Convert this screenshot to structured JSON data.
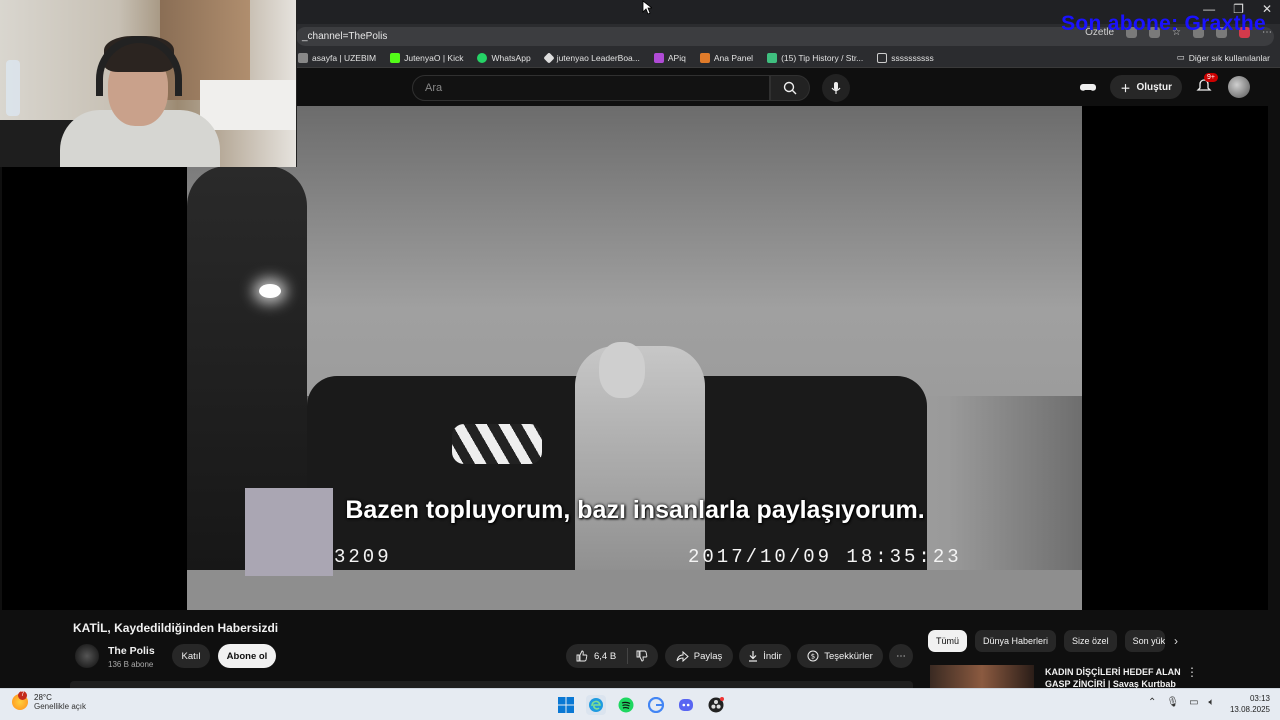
{
  "browser": {
    "url": "_channel=ThePolis",
    "url_right_label": "Özetle",
    "bookmarks": [
      {
        "label": "asayfa | UZEBIM",
        "color": "#888888"
      },
      {
        "label": "JutenyaO | Kick",
        "color": "#53fc18"
      },
      {
        "label": "WhatsApp",
        "color": "#25d366"
      },
      {
        "label": "jutenyao LeaderBoa...",
        "color": "#dddddd"
      },
      {
        "label": "APiq",
        "color": "#b04bd6"
      },
      {
        "label": "Ana Panel",
        "color": "#e07b2a"
      },
      {
        "label": "(15) Tip History / Str...",
        "color": "#3fbf7f"
      },
      {
        "label": "ssssssssss",
        "color": "#cccccc"
      }
    ],
    "other_bookmarks": "Diğer sık kullanılanlar"
  },
  "overlay": {
    "last_subscriber": "Son abone: Graxthe"
  },
  "youtube": {
    "search_placeholder": "Ara",
    "create_label": "Oluştur",
    "notification_count": "9+"
  },
  "video": {
    "subtitle": "Bazen topluyorum, bazı insanlarla paylaşıyorum.",
    "stamp_id": "3209",
    "stamp_datetime": "2017/10/09  18:35:23"
  },
  "info": {
    "title": "KATİL, Kaydedildiğinden Habersizdi",
    "channel_name": "The Polis",
    "subscribers": "136 B abone",
    "join_label": "Katıl",
    "subscribe_label": "Abone ol",
    "likes": "6,4 B",
    "share_label": "Paylaş",
    "download_label": "İndir",
    "thanks_label": "Teşekkürler"
  },
  "chips": [
    "Tümü",
    "Dünya Haberleri",
    "Size özel",
    "Son yük"
  ],
  "recommendation": {
    "title": "KADIN DİŞÇİLERİ HEDEF ALAN GASP ZİNCİRİ | Savaş Kurtbab"
  },
  "taskbar": {
    "weather_badge": "7",
    "temperature": "28°C",
    "weather_desc": "Genellikle açık",
    "time": "03:13",
    "date": "13.08.2025"
  }
}
